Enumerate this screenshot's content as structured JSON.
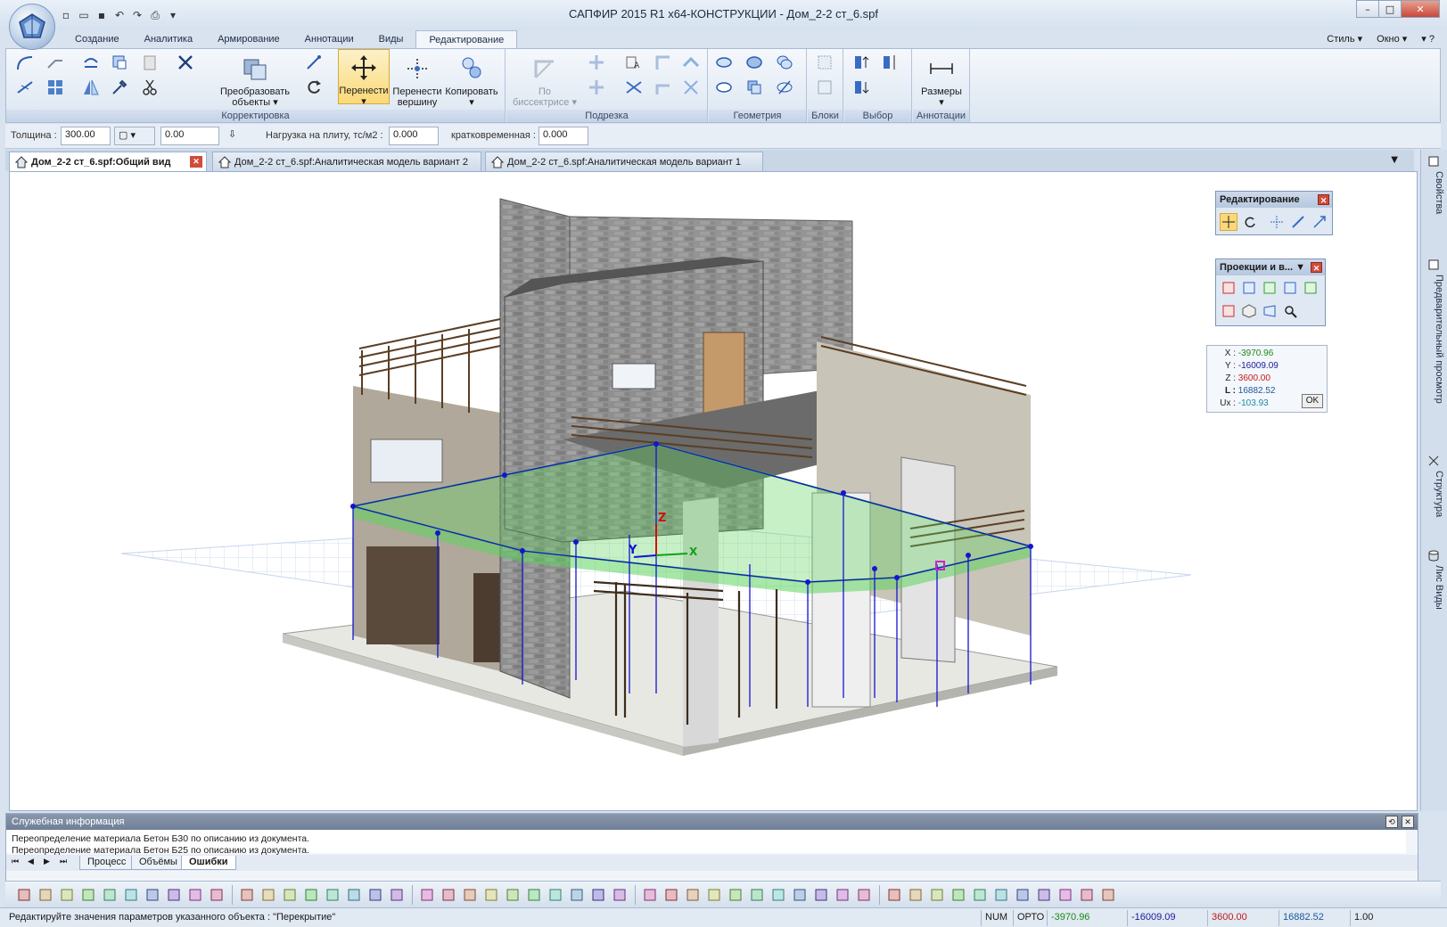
{
  "window": {
    "title": "САПФИР 2015 R1 x64-КОНСТРУКЦИИ - Дом_2-2 ст_6.spf",
    "controls": [
      "–",
      "□",
      "✕"
    ]
  },
  "quick_access": [
    "new-icon",
    "open-icon",
    "save-icon",
    "undo-icon",
    "redo-icon",
    "print-icon",
    "customize-icon"
  ],
  "ribbon": {
    "tabs": [
      "Создание",
      "Аналитика",
      "Армирование",
      "Аннотации",
      "Виды",
      "Редактирование"
    ],
    "active_tab": "Редактирование",
    "menu_right": [
      "Стиль",
      "Окно"
    ],
    "groups": {
      "korrektirovka": {
        "label": "Корректировка",
        "transform_label_1": "Преобразовать",
        "transform_label_2": "объекты"
      },
      "move": {
        "move_label": "Перенести",
        "move_vertex_1": "Перенести",
        "move_vertex_2": "вершину",
        "copy": "Копировать"
      },
      "podrezka": {
        "label": "Подрезка",
        "bisector_1": "По",
        "bisector_2": "биссектрисе"
      },
      "geometry": {
        "label": "Геометрия"
      },
      "blocks": {
        "label": "Блоки"
      },
      "select": {
        "label": "Выбор"
      },
      "annotations": {
        "label": "Аннотации",
        "dimensions": "Размеры"
      }
    }
  },
  "params": {
    "thickness_label": "Толщина :",
    "thickness_value": "300.00",
    "offset_value": "0.00",
    "load_label": "Нагрузка на плиту, тс/м2 :",
    "load_value": "0.000",
    "short_label": "кратковременная :",
    "short_value": "0.000"
  },
  "doc_tabs": [
    "Дом_2-2 ст_6.spf:Общий вид",
    "Дом_2-2 ст_6.spf:Аналитическая модель вариант 2",
    "Дом_2-2 ст_6.spf:Аналитическая модель вариант 1"
  ],
  "panels": {
    "edit": {
      "title": "Редактирование"
    },
    "projections": {
      "title": "Проекции и в..."
    }
  },
  "coords": {
    "x_label": "X :",
    "x": "-3970.96",
    "y_label": "Y :",
    "y": "-16009.09",
    "z_label": "Z :",
    "z": "3600.00",
    "l_label": "L :",
    "l": "16882.52",
    "ux_label": "Ux :",
    "ux": "-103.93",
    "ok": "OK"
  },
  "axes": {
    "x": "X",
    "y": "Y",
    "z": "Z"
  },
  "sidebar": [
    "Свойства",
    "Предварительный просмотр",
    "Структура",
    "Лис Виды"
  ],
  "service": {
    "title": "Служебная информация",
    "lines": [
      "Переопределение материала Бетон Б30 по описанию из документа.",
      "Переопределение материала Бетон Б25 по описанию из документа."
    ],
    "tabs": [
      "Процесс",
      "Объёмы",
      "Ошибки"
    ],
    "active_tab": "Ошибки"
  },
  "status": {
    "message": "Редактируйте значения параметров указанного объекта : \"Перекрытие\"",
    "num": "NUM",
    "orto": "ОРТО",
    "x": "-3970.96",
    "y": "-16009.09",
    "z": "3600.00",
    "l": "16882.52",
    "scale": "1.00"
  },
  "colors": {
    "accent": "#fbd978",
    "slab": "#6fd36f",
    "analytic_lines": "#1414d0",
    "brick": "#8a8a8a",
    "x_coord": "#1a8a1a",
    "y_coord": "#1a1a9a",
    "z_coord": "#c01a1a"
  }
}
